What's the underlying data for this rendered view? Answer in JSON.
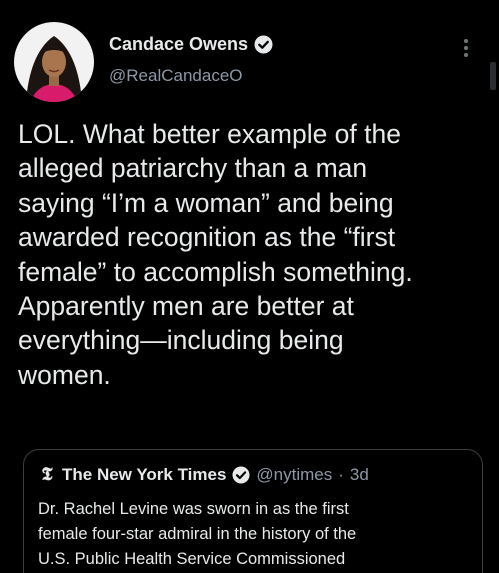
{
  "tweet": {
    "author": {
      "display_name": "Candace Owens",
      "handle": "@RealCandaceO",
      "verified": true
    },
    "text": "LOL. What better example of the\nalleged patriarchy than a man\nsaying “I’m a woman” and being\nawarded recognition as the “first\nfemale” to accomplish something.\nApparently men are better at\neverything—including being\nwomen.",
    "menu_icon": "more-vertical-icon"
  },
  "quoted_tweet": {
    "author": {
      "display_name": "The New York Times",
      "handle": "@nytimes",
      "verified": true,
      "logo_glyph": "𝕿"
    },
    "separator": "·",
    "timestamp": "3d",
    "text": "Dr. Rachel Levine was sworn in as  the first\nfemale four-star admiral in the history of the\nU.S. Public Health Service Commissioned"
  },
  "colors": {
    "background": "#000000",
    "primary_text": "#e7e9ea",
    "secondary_text": "#8b98a5",
    "border": "#3a3e43",
    "avatar_accent": "#d81b6a"
  }
}
